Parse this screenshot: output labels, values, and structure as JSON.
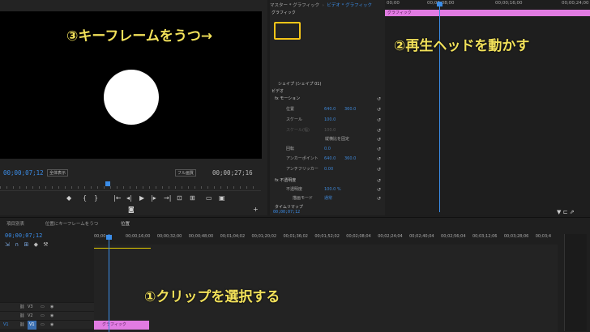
{
  "program": {
    "timecode": "00;00;07;12",
    "zoom_select": "全体表示",
    "quality_select": "フル画質",
    "duration": "00;00;27;16"
  },
  "effect_controls": {
    "tabs": [
      "マスター * グラフィック",
      "ビデオ * グラフィック"
    ],
    "rows": [
      {
        "label": "グラフィック",
        "indent": 2,
        "kind": "hdr"
      },
      {
        "label": "シェイプ (シェイプ 01)",
        "indent": 10,
        "kind": "hdr"
      },
      {
        "label": "ビデオ",
        "indent": 2,
        "kind": "hdr"
      },
      {
        "label": "fx モーション",
        "indent": 6,
        "kind": "hdr"
      },
      {
        "label": "位置",
        "indent": 20,
        "v1": "640.0",
        "v2": "360.0"
      },
      {
        "label": "スケール",
        "indent": 20,
        "v1": "100.0"
      },
      {
        "label": "スケール(幅)",
        "indent": 20,
        "v1": "100.0",
        "dim": true
      },
      {
        "label": "縦横比を固定",
        "indent": 68
      },
      {
        "label": "回転",
        "indent": 20,
        "v1": "0.0"
      },
      {
        "label": "アンカーポイント",
        "indent": 20,
        "v1": "640.0",
        "v2": "360.0"
      },
      {
        "label": "アンチフリッカー",
        "indent": 20,
        "v1": "0.00"
      },
      {
        "label": "fx 不透明度",
        "indent": 6,
        "kind": "hdr"
      },
      {
        "label": "不透明度",
        "indent": 20,
        "v1": "100.0 %"
      },
      {
        "label": "描画モード",
        "indent": 28,
        "v1": "通常"
      },
      {
        "label": "タイムリマップ",
        "indent": 6,
        "kind": "hdr"
      }
    ],
    "bottom_timecode": "00;00;07;12"
  },
  "ec_timeline": {
    "ruler": [
      "00;00",
      "00;00;08;00",
      "00;00;16;00",
      "00;00;24;00"
    ],
    "clip_label": "グラフィック"
  },
  "timeline": {
    "tabs": [
      "項目別表",
      "位置にキーフレームをうつ",
      "位置"
    ],
    "timecode": "00;00;07;12",
    "ruler": [
      "00;00",
      "00;00;16;00",
      "00;00;32;00",
      "00;00;48;00",
      "00;01;04;02",
      "00;01;20;02",
      "00;01;36;02",
      "00;01;52;02",
      "00;02;08;04",
      "00;02;24;04",
      "00;02;40;04",
      "00;02;56;04",
      "00;03;12;06",
      "00;03;28;06",
      "00;03;4"
    ],
    "tracks": [
      "V3",
      "V2",
      "V1"
    ],
    "clip_label": "グラフィック"
  },
  "annotations": {
    "a1": "①クリップを選択する",
    "a2": "②再生ヘッドを動かす",
    "a3": "③キーフレームをうつ→"
  },
  "colors": {
    "accent_blue": "#3b8de8",
    "clip_pink": "#e17be2",
    "annotation_yellow": "#f2e15a",
    "highlight_box": "#f5c518"
  }
}
